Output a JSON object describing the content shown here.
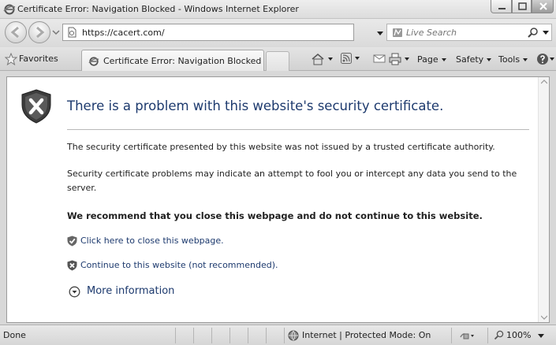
{
  "window": {
    "title": "Certificate Error: Navigation Blocked - Windows Internet Explorer",
    "controls": [
      "minimize-icon",
      "maximize-icon",
      "close-icon"
    ]
  },
  "address_bar": {
    "url": "https://cacert.com/",
    "search_placeholder": "Live Search"
  },
  "toolbar": {
    "favorites_label": "Favorites",
    "tab_label": "Certificate Error: Navigation Blocked",
    "page_label": "Page",
    "safety_label": "Safety",
    "tools_label": "Tools"
  },
  "content": {
    "heading": "There is a problem with this website's security certificate.",
    "para_1": "The security certificate presented by this website was not issued by a trusted certificate authority.",
    "para_2": "Security certificate problems may indicate an attempt to fool you or intercept any data you send to the server.",
    "recommendation": "We recommend that you close this webpage and do not continue to this website.",
    "close_link": "Click here to close this webpage.",
    "continue_link": "Continue to this website (not recommended).",
    "more_info": "More information"
  },
  "status_bar": {
    "status": "Done",
    "zone": "Internet | Protected Mode: On",
    "zoom": "100%"
  },
  "colors": {
    "heading_text": "#1d3a6e",
    "chrome": "#dcdcdc",
    "close_button": "#9b9b9b"
  }
}
